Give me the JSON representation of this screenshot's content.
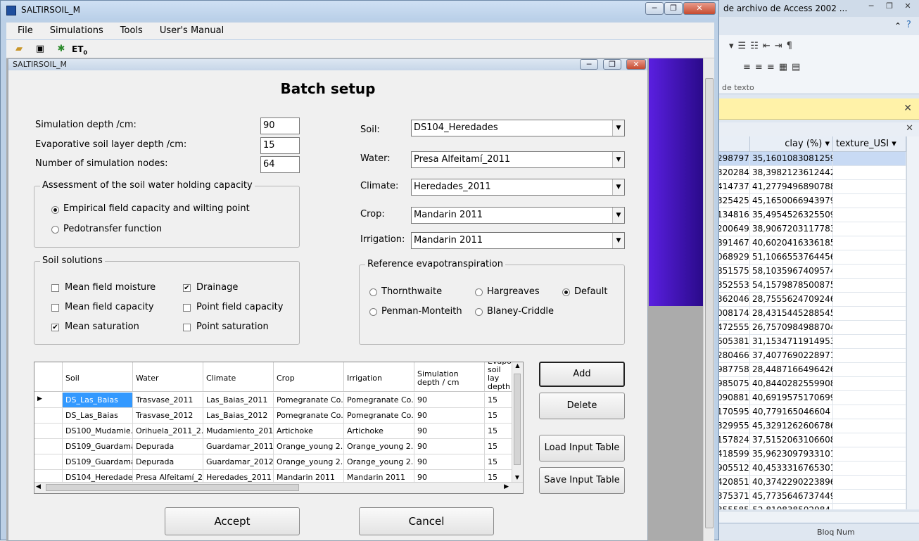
{
  "main_window": {
    "title": "SALTIRSOIL_M",
    "menu": [
      "File",
      "Simulations",
      "Tools",
      "User's Manual"
    ],
    "toolbar_et_label": "ET",
    "toolbar_et_sub": "0"
  },
  "child_window": {
    "title": "SALTIRSOIL_M"
  },
  "batch": {
    "heading": "Batch setup",
    "sim_depth_label": "Simulation depth /cm:",
    "sim_depth_value": "90",
    "evap_depth_label": "Evaporative soil layer depth /cm:",
    "evap_depth_value": "15",
    "nodes_label": "Number of simulation nodes:",
    "nodes_value": "64",
    "whc_group": "Assessment of the soil water holding capacity",
    "whc_opt1": "Empirical field capacity and wilting point",
    "whc_opt2": "Pedotransfer function",
    "solutions_group": "Soil solutions",
    "sol_mean_moisture": "Mean field moisture",
    "sol_mean_capacity": "Mean field capacity",
    "sol_mean_saturation": "Mean saturation",
    "sol_drainage": "Drainage",
    "sol_point_capacity": "Point field capacity",
    "sol_point_saturation": "Point saturation",
    "soil_label": "Soil:",
    "soil_value": "DS104_Heredades",
    "water_label": "Water:",
    "water_value": "Presa Alfeitamí_2011",
    "climate_label": "Climate:",
    "climate_value": "Heredades_2011",
    "crop_label": "Crop:",
    "crop_value": "Mandarin 2011",
    "irrigation_label": "Irrigation:",
    "irrigation_value": "Mandarin 2011",
    "et_group": "Reference evapotranspiration",
    "et_thornthwaite": "Thornthwaite",
    "et_hargreaves": "Hargreaves",
    "et_default": "Default",
    "et_penman": "Penman-Monteith",
    "et_blaney": "Blaney-Criddle",
    "add_button": "Add",
    "delete_button": "Delete",
    "load_button": "Load Input Table",
    "save_button": "Save Input Table",
    "accept_button": "Accept",
    "cancel_button": "Cancel"
  },
  "grid": {
    "headers": [
      "Soil",
      "Water",
      "Climate",
      "Crop",
      "Irrigation",
      "Simulation depth / cm",
      "Evapo soil lay depth ."
    ],
    "rows": [
      [
        "DS_Las_Baias",
        "Trasvase_2011",
        "Las_Baias_2011",
        "Pomegranate Co...",
        "Pomegranate Co...",
        "90",
        "15"
      ],
      [
        "DS_Las_Baias",
        "Trasvase_2012",
        "Las_Baias_2012",
        "Pomegranate Co...",
        "Pomegranate Co...",
        "90",
        "15"
      ],
      [
        "DS100_Mudamie...",
        "Orihuela_2011_2...",
        "Mudamiento_201...",
        "Artichoke",
        "Artichoke",
        "90",
        "15"
      ],
      [
        "DS109_Guardamar",
        "Depurada",
        "Guardamar_2011",
        "Orange_young 2...",
        "Orange_young 2...",
        "90",
        "15"
      ],
      [
        "DS109_Guardamar",
        "Depurada",
        "Guardamar_2012",
        "Orange_young 2...",
        "Orange_young 2...",
        "90",
        "15"
      ],
      [
        "DS104_Heredades",
        "Presa Alfeitamí_2...",
        "Heredades_2011",
        "Mandarin 2011",
        "Mandarin 2011",
        "90",
        "15"
      ]
    ]
  },
  "access": {
    "title": "de archivo de Access 2002 ...",
    "ribbon_group": "de texto",
    "col_clay": "clay (%)",
    "col_texture": "texture_USI",
    "rows": [
      [
        "298797",
        "35,1601083081259"
      ],
      [
        "320284",
        "38,3982123612442"
      ],
      [
        "414737",
        "41,2779496890788"
      ],
      [
        "325425",
        "45,1650066943979"
      ],
      [
        "134816",
        "35,4954526325509"
      ],
      [
        "200649",
        "38,9067203117783"
      ],
      [
        "891467",
        "40,6020416336185"
      ],
      [
        "068929",
        "51,1066553764456"
      ],
      [
        "851575",
        "58,1035967409574"
      ],
      [
        "352553",
        "54,1579878500875"
      ],
      [
        "362046",
        "28,7555624709246"
      ],
      [
        "008174",
        "28,4315445288545"
      ],
      [
        "472555",
        "26,7570984988704"
      ],
      [
        "605381",
        "31,1534711914953"
      ],
      [
        "280466",
        "37,4077690228971"
      ],
      [
        "987758",
        "28,4487166496426"
      ],
      [
        "985075",
        "40,8440282559908"
      ],
      [
        "090881",
        "40,6919575170699"
      ],
      [
        "170595",
        "40,779165046604"
      ],
      [
        "329955",
        "45,3291262606786"
      ],
      [
        "157824",
        "37,5152063106608"
      ],
      [
        "418599",
        "35,9623097933101"
      ],
      [
        "905512",
        "40,4533316765301"
      ],
      [
        "420851",
        "40,3742290223896"
      ],
      [
        "375371",
        "45,7735646737449"
      ],
      [
        "355585",
        "52,810838592984"
      ]
    ],
    "status": "Bloq Num"
  }
}
